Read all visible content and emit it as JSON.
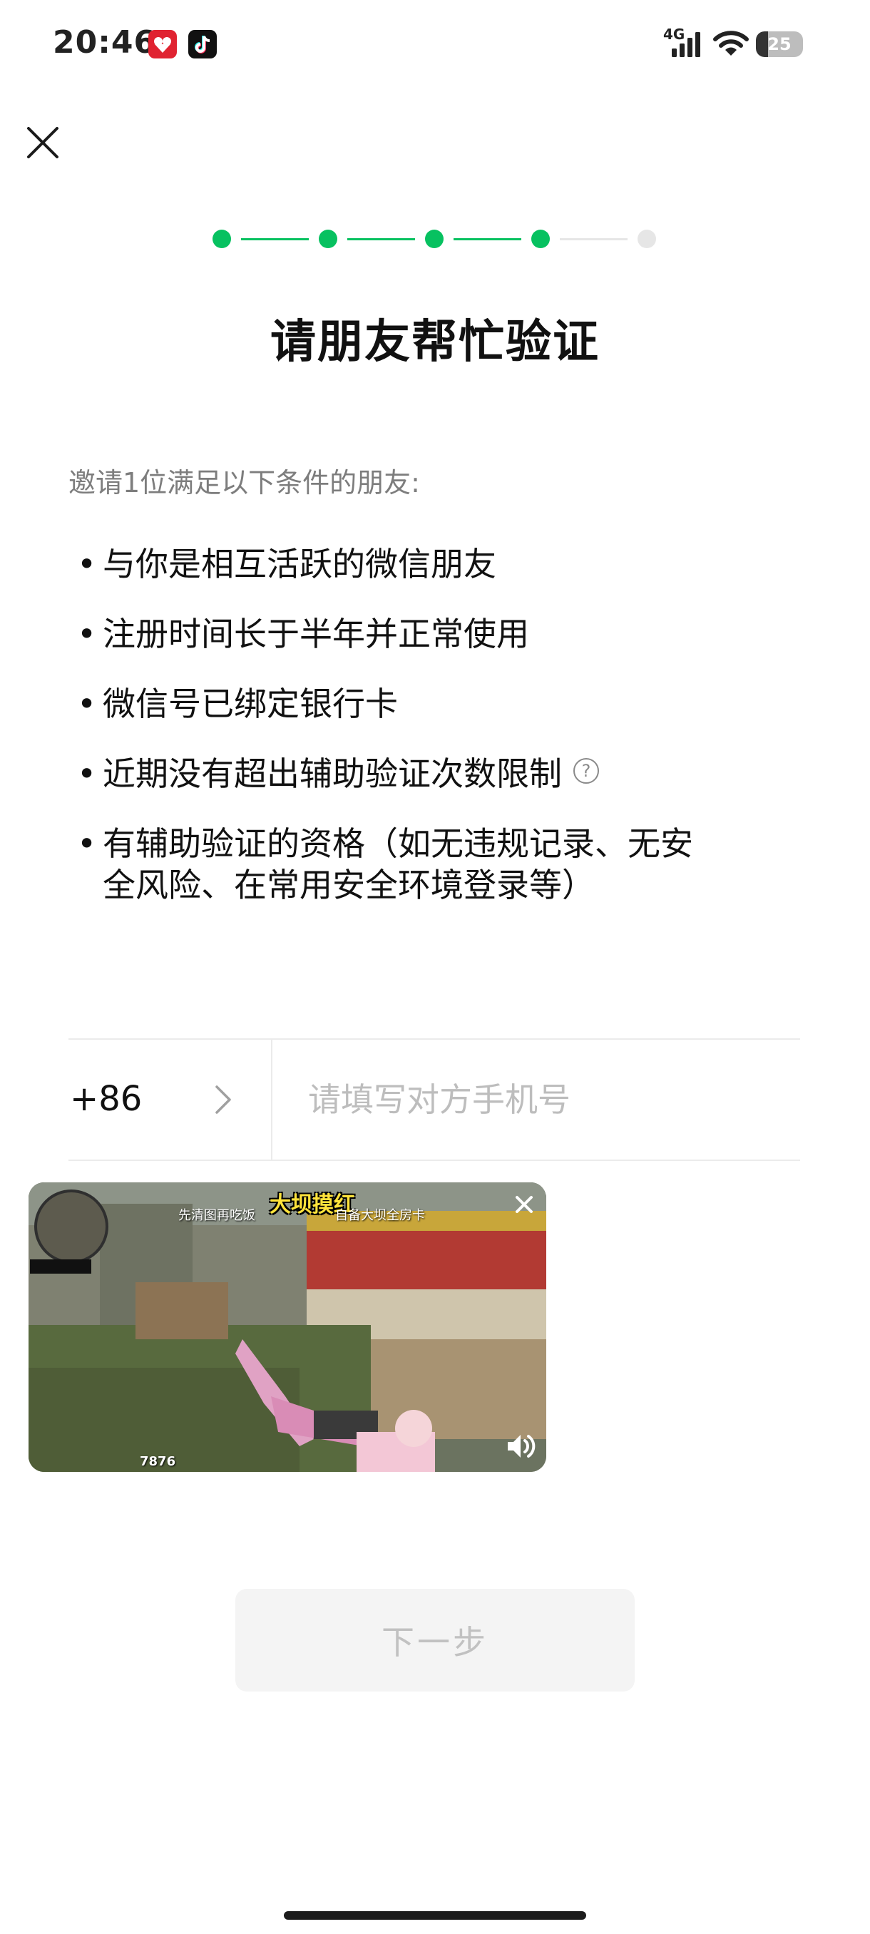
{
  "status_bar": {
    "time": "20:46",
    "network": "4G",
    "battery": "25",
    "battery_level": 0.25
  },
  "header": {
    "close_icon": "close-icon"
  },
  "progress": {
    "total_steps": 5,
    "current_step": 4,
    "active_color": "#07c160",
    "inactive_color": "#e6e6e6"
  },
  "page": {
    "title": "请朋友帮忙验证",
    "intro": "邀请1位满足以下条件的朋友:",
    "conditions": [
      "与你是相互活跃的微信朋友",
      "注册时间长于半年并正常使用",
      "微信号已绑定银行卡",
      "近期没有超出辅助验证次数限制",
      "有辅助验证的资格（如无违规记录、无安全风险、在常用安全环境登录等）"
    ],
    "conditions_line5_part1": "有辅助验证的资格（如无违规记录、无安",
    "conditions_line5_part2": "全风险、在常用安全环境登录等）"
  },
  "phone_input": {
    "country_code": "+86",
    "value": "",
    "placeholder": "请填写对方手机号"
  },
  "video": {
    "title": "大坝摸红",
    "subtitle_left": "先清图再吃饭",
    "subtitle_right": "自备大坝全房卡",
    "score": "7876"
  },
  "actions": {
    "next_label": "下一步"
  }
}
